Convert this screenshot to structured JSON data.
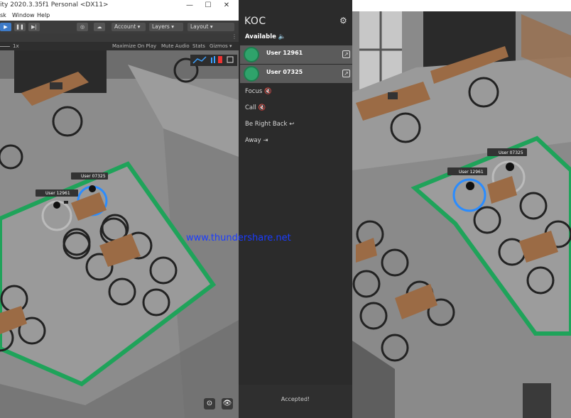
{
  "unity": {
    "title": "ity 2020.3.35f1 Personal <DX11>",
    "window_controls": {
      "minimize": "—",
      "maximize": "☐",
      "close": "✕"
    },
    "menu": [
      "sk",
      "Window",
      "Help"
    ],
    "toolbar": {
      "account": "Account ▾",
      "layers": "Layers ▾",
      "layout": "Layout ▾"
    },
    "scale_label": "1x",
    "game_options": [
      "Maximize On Play",
      "Mute Audio",
      "Stats",
      "Gizmos ▾"
    ],
    "scene_tags": [
      "User 07325",
      "User 12961"
    ]
  },
  "panel": {
    "app_name": "KOC",
    "available_label": "Available",
    "users": [
      {
        "name": "User 12961"
      },
      {
        "name": "User 07325"
      }
    ],
    "statuses": [
      {
        "label": "Focus",
        "icon": "mute-icon"
      },
      {
        "label": "Call",
        "icon": "mute-icon"
      },
      {
        "label": "Be Right Back",
        "icon": "return-icon"
      },
      {
        "label": "Away",
        "icon": "exit-icon"
      }
    ],
    "footer": "Accepted!"
  },
  "right_view": {
    "scene_tags": [
      "User 07325",
      "User 12961"
    ]
  },
  "watermark": "www.thundershare.net",
  "colors": {
    "zone_green": "#1fa35a",
    "ring_blue": "#2a8cff",
    "panel_bg": "#2b2b2b",
    "row_bg": "#5b5b5b",
    "play_blue": "#3d7ac7"
  }
}
